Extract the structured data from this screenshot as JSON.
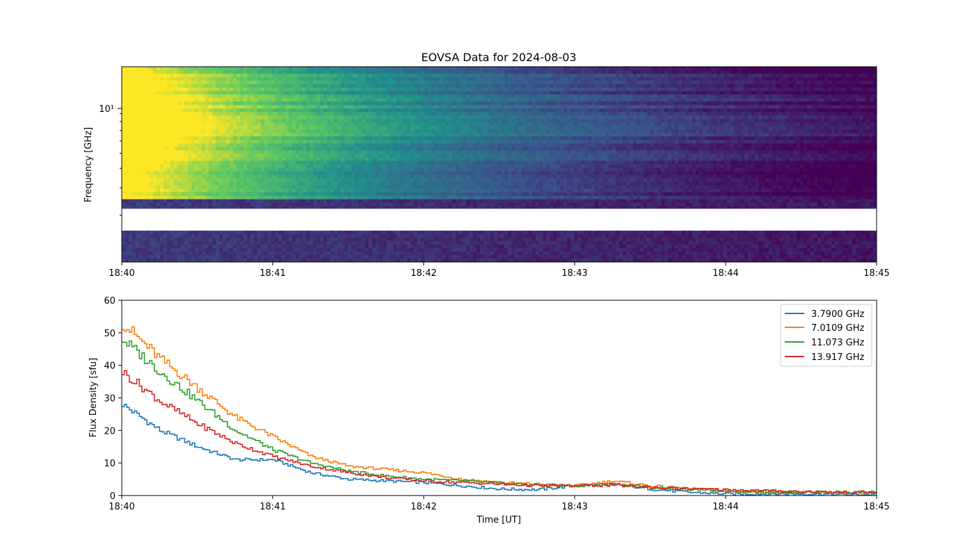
{
  "figure": {
    "title": "EOVSA Data for 2024-08-03"
  },
  "chart_data": [
    {
      "type": "heatmap",
      "ylabel": "Frequency [GHz]",
      "yscale": "log",
      "y_tick_label": "10¹",
      "ylim_ghz": [
        1.0,
        18.0
      ],
      "x_tick_labels": [
        "18:40",
        "18:41",
        "18:42",
        "18:43",
        "18:44",
        "18:45"
      ],
      "xlim": [
        "18:40",
        "18:45"
      ],
      "colormap": [
        "#440154",
        "#3b528b",
        "#21918c",
        "#5ec962",
        "#fde725"
      ],
      "missing_band_ghz": [
        1.6,
        2.2
      ],
      "description_note": ""
    },
    {
      "type": "line",
      "step": true,
      "xlabel": "Time [UT]",
      "ylabel": "Flux Density [sfu]",
      "ylim": [
        0,
        60
      ],
      "y_ticks": [
        "0",
        "10",
        "20",
        "30",
        "40",
        "50",
        "60"
      ],
      "x_tick_labels": [
        "18:40",
        "18:41",
        "18:42",
        "18:43",
        "18:44",
        "18:45"
      ],
      "xlim_min": [
        0,
        5
      ],
      "legend_loc": "upper right",
      "series": [
        {
          "name": "3.7900 GHz",
          "color": "#1f77b4",
          "x": [
            0,
            0.25,
            0.5,
            0.75,
            1.0,
            1.25,
            1.5,
            1.75,
            2.0,
            2.25,
            2.5,
            2.75,
            3.0,
            3.25,
            3.5,
            3.75,
            4.0,
            4.25,
            4.5,
            4.75,
            5.0
          ],
          "y": [
            28,
            20,
            15,
            11,
            11,
            7,
            5,
            4.5,
            4,
            3,
            2,
            1.8,
            3,
            3.5,
            2,
            1,
            0.5,
            0.5,
            0.5,
            0.3,
            0.2
          ]
        },
        {
          "name": "7.0109 GHz",
          "color": "#ff7f0e",
          "x": [
            0,
            0.25,
            0.5,
            0.75,
            1.0,
            1.25,
            1.5,
            1.75,
            2.0,
            2.25,
            2.5,
            2.75,
            3.0,
            3.25,
            3.5,
            3.75,
            4.0,
            4.25,
            4.5,
            4.75,
            5.0
          ],
          "y": [
            53,
            42,
            33,
            24,
            18,
            12,
            9,
            8,
            7,
            5,
            4,
            3.5,
            3,
            4.5,
            3,
            2,
            1.2,
            1,
            1,
            0.8,
            0.8
          ]
        },
        {
          "name": "11.073 GHz",
          "color": "#2ca02c",
          "x": [
            0,
            0.25,
            0.5,
            0.75,
            1.0,
            1.25,
            1.5,
            1.75,
            2.0,
            2.25,
            2.5,
            2.75,
            3.0,
            3.25,
            3.5,
            3.75,
            4.0,
            4.25,
            4.5,
            4.75,
            5.0
          ],
          "y": [
            48,
            38,
            29,
            20,
            14,
            10,
            7.5,
            6,
            5,
            4.5,
            3.8,
            3.2,
            3,
            3.5,
            2.5,
            2,
            1.5,
            1.2,
            1,
            1,
            1
          ]
        },
        {
          "name": "13.917 GHz",
          "color": "#d62728",
          "x": [
            0,
            0.25,
            0.5,
            0.75,
            1.0,
            1.25,
            1.5,
            1.75,
            2.0,
            2.25,
            2.5,
            2.75,
            3.0,
            3.25,
            3.5,
            3.75,
            4.0,
            4.25,
            4.5,
            4.75,
            5.0
          ],
          "y": [
            38,
            29,
            22,
            16,
            12,
            9,
            7,
            5.5,
            4.5,
            4,
            3.5,
            3,
            3,
            3.2,
            2.5,
            2,
            1.8,
            1.5,
            1.2,
            1,
            1
          ]
        }
      ]
    }
  ]
}
